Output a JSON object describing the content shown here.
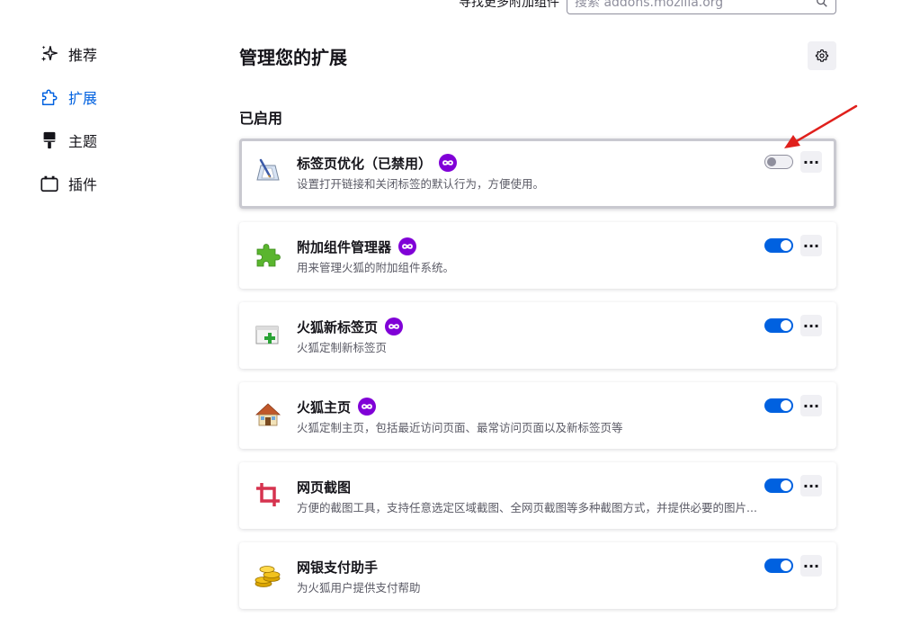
{
  "top": {
    "find_more_label": "寻找更多附加组件",
    "search_placeholder": "搜索 addons.mozilla.org"
  },
  "sidebar": {
    "items": [
      {
        "label": "推荐",
        "icon": "sparkle-icon",
        "active": false
      },
      {
        "label": "扩展",
        "icon": "puzzle-icon",
        "active": true
      },
      {
        "label": "主题",
        "icon": "brush-icon",
        "active": false
      },
      {
        "label": "插件",
        "icon": "plugin-icon",
        "active": false
      }
    ]
  },
  "main": {
    "title": "管理您的扩展",
    "section_enabled": "已启用",
    "extensions": [
      {
        "name": "标签页优化（已禁用）",
        "desc": "设置打开链接和关闭标签的默认行为，方便使用。",
        "icon": "tab-optimize-icon",
        "badge": true,
        "enabled": false
      },
      {
        "name": "附加组件管理器",
        "desc": "用来管理火狐的附加组件系统。",
        "icon": "green-puzzle-icon",
        "badge": true,
        "enabled": true
      },
      {
        "name": "火狐新标签页",
        "desc": "火狐定制新标签页",
        "icon": "new-tab-icon",
        "badge": true,
        "enabled": true
      },
      {
        "name": "火狐主页",
        "desc": "火狐定制主页，包括最近访问页面、最常访问页面以及新标签页等",
        "icon": "house-icon",
        "badge": true,
        "enabled": true
      },
      {
        "name": "网页截图",
        "desc": "方便的截图工具，支持任意选定区域截图、全网页截图等多种截图方式，并提供必要的图片...",
        "icon": "crop-icon",
        "badge": false,
        "enabled": true
      },
      {
        "name": "网银支付助手",
        "desc": "为火狐用户提供支付帮助",
        "icon": "coins-icon",
        "badge": false,
        "enabled": true
      }
    ]
  },
  "colors": {
    "accent": "#0061e0",
    "badge": "#8000d7",
    "annotation": "#e0201c"
  }
}
